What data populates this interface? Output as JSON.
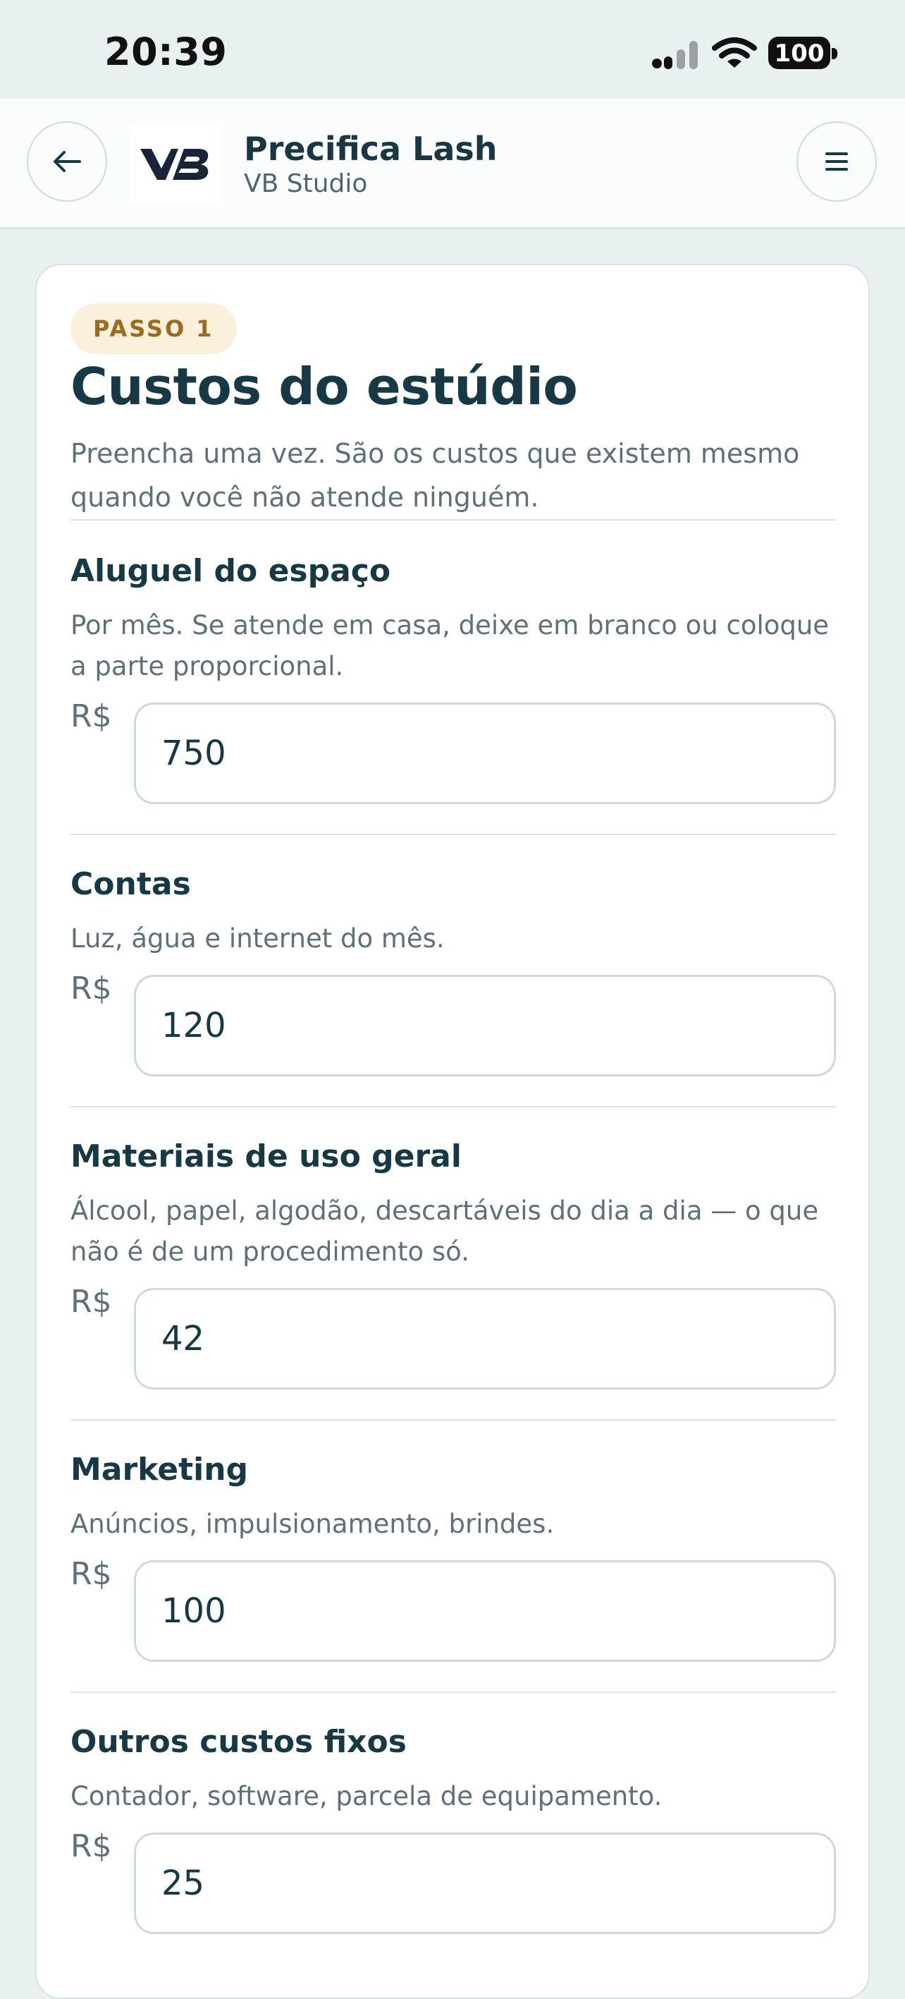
{
  "status_bar": {
    "time": "20:39",
    "battery": "100",
    "icons": [
      "signal-icon",
      "wifi-icon",
      "battery-icon"
    ]
  },
  "header": {
    "back_icon": "arrow-left-icon",
    "logo_text": "VB",
    "title": "Precifica Lash",
    "subtitle": "VB Studio",
    "menu_icon": "hamburger-menu-icon"
  },
  "step": {
    "badge": "PASSO 1",
    "title": "Custos do estúdio",
    "description": "Preencha uma vez. São os custos que existem mesmo quando você não atende ninguém."
  },
  "fields": [
    {
      "label": "Aluguel do espaço",
      "help": "Por mês. Se atende em casa, deixe em branco ou coloque a parte proporcional.",
      "currency": "R$",
      "value": "750"
    },
    {
      "label": "Contas",
      "help": "Luz, água e internet do mês.",
      "currency": "R$",
      "value": "120"
    },
    {
      "label": "Materiais de uso geral",
      "help": "Álcool, papel, algodão, descartáveis do dia a dia — o que não é de um procedimento só.",
      "currency": "R$",
      "value": "42"
    },
    {
      "label": "Marketing",
      "help": "Anúncios, impulsionamento, brindes.",
      "currency": "R$",
      "value": "100"
    },
    {
      "label": "Outros custos fixos",
      "help": "Contador, software, parcela de equipamento.",
      "currency": "R$",
      "value": "25"
    }
  ],
  "colors": {
    "background": "#e8f0f1",
    "card": "#ffffff",
    "text_primary": "#173945",
    "text_secondary": "#5e7178",
    "badge_bg": "#fbf0db",
    "badge_text": "#9a6a1e",
    "border": "#cbdadd"
  }
}
